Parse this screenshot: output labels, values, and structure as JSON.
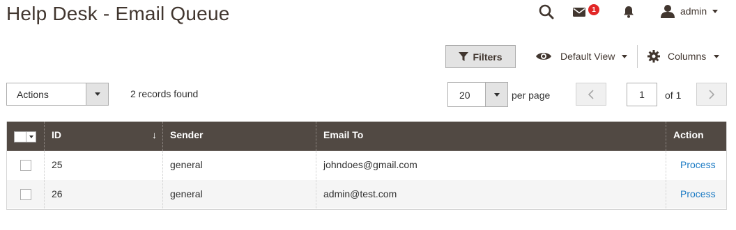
{
  "page": {
    "title": "Help Desk - Email Queue"
  },
  "header": {
    "notifications_count": "1",
    "user": "admin"
  },
  "toolbar": {
    "filters_label": "Filters",
    "view_label": "Default View",
    "columns_label": "Columns",
    "actions_label": "Actions",
    "records_found": "2 records found",
    "per_page_value": "20",
    "per_page_label": "per page",
    "current_page": "1",
    "of_pages": "of 1"
  },
  "grid": {
    "columns": [
      "ID",
      "Sender",
      "Email To",
      "Action"
    ],
    "rows": [
      {
        "id": "25",
        "sender": "general",
        "email_to": "johndoes@gmail.com",
        "action": "Process"
      },
      {
        "id": "26",
        "sender": "general",
        "email_to": "admin@test.com",
        "action": "Process"
      }
    ]
  },
  "colors": {
    "header_bg": "#514943",
    "link": "#1979c3",
    "badge": "#e22626"
  }
}
